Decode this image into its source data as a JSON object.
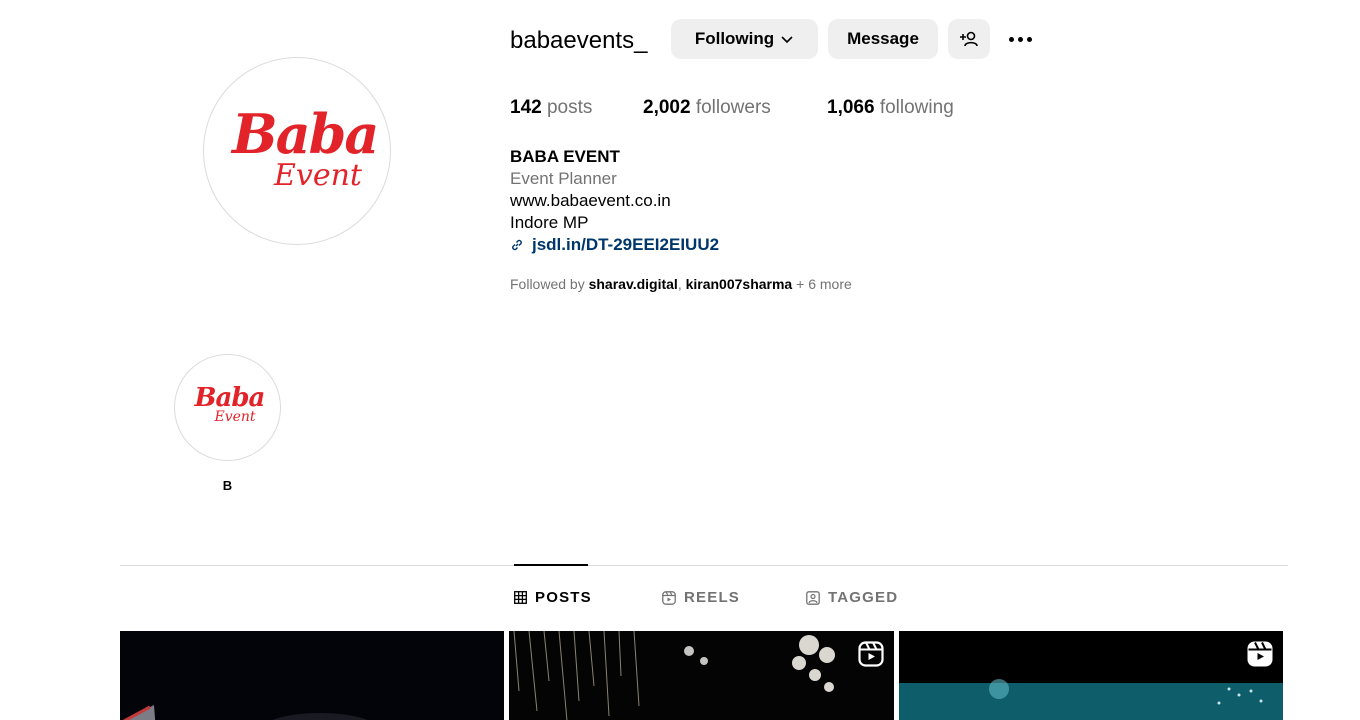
{
  "profile": {
    "username": "babaevents_",
    "logo_text_main": "Baba",
    "logo_text_sub": "Event"
  },
  "actions": {
    "following_label": "Following",
    "message_label": "Message"
  },
  "stats": {
    "posts_count": "142",
    "posts_label": "posts",
    "followers_count": "2,002",
    "followers_label": "followers",
    "following_count": "1,066",
    "following_label": "following"
  },
  "bio": {
    "name": "BABA EVENT",
    "category": "Event Planner",
    "line1": "www.babaevent.co.in",
    "line2": "Indore MP",
    "link": "jsdl.in/DT-29EEI2EIUU2"
  },
  "followed_by": {
    "prefix": "Followed by",
    "user1": "sharav.digital",
    "separator": ",",
    "user2": "kiran007sharma",
    "more": "+ 6 more"
  },
  "highlights": [
    {
      "label": "B",
      "logo_main": "Baba",
      "logo_sub": "Event"
    }
  ],
  "tabs": [
    {
      "label": "POSTS",
      "icon": "grid-icon",
      "active": true
    },
    {
      "label": "REELS",
      "icon": "reels-icon",
      "active": false
    },
    {
      "label": "TAGGED",
      "icon": "tagged-icon",
      "active": false
    }
  ],
  "posts": [
    {
      "type": "image"
    },
    {
      "type": "reel",
      "icon": "reel-icon"
    },
    {
      "type": "reel",
      "icon": "reel-icon"
    }
  ],
  "colors": {
    "brand_red": "#e2242a",
    "link_blue": "#00376b",
    "muted_gray": "#737373",
    "button_gray": "#efefef"
  }
}
